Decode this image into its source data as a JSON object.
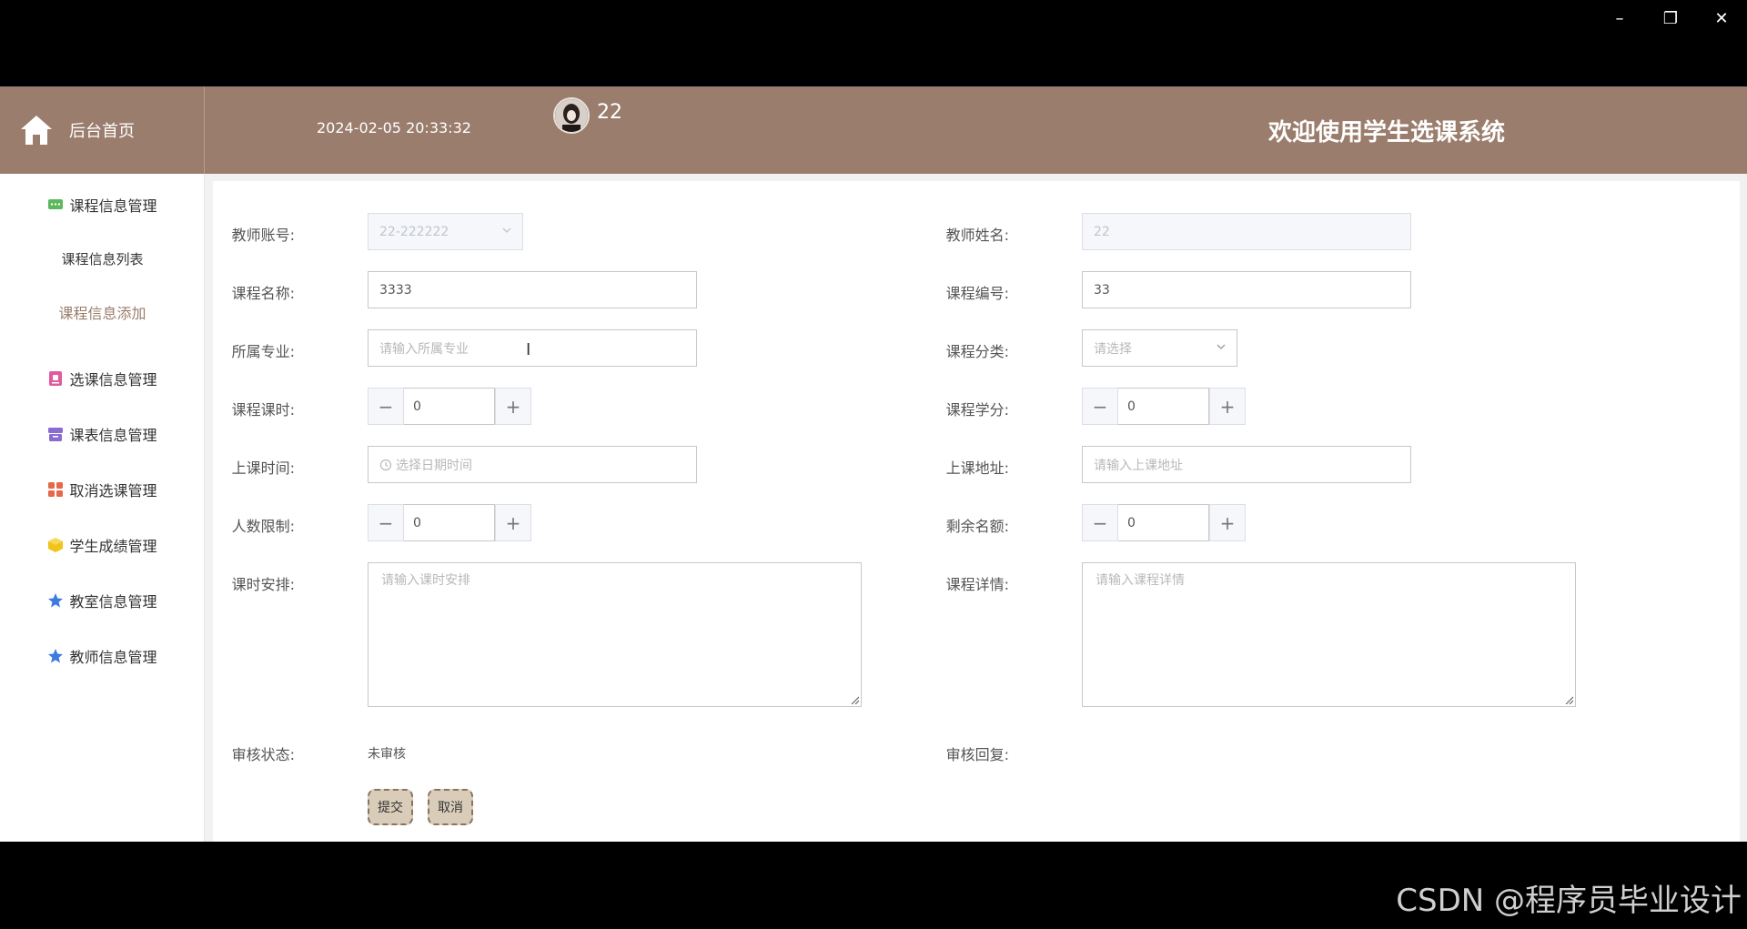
{
  "window": {
    "controls": [
      "–",
      "❐",
      "✕"
    ]
  },
  "header": {
    "home_label": "后台首页",
    "datetime": "2024-02-05 20:33:32",
    "username": "22",
    "welcome": "欢迎使用学生选课系统"
  },
  "sidebar": {
    "items": [
      {
        "label": "课程信息管理",
        "icon": "chat-icon",
        "color": "#5cb85c"
      },
      {
        "label": "课程信息列表"
      },
      {
        "label": "课程信息添加"
      },
      {
        "label": "选课信息管理",
        "icon": "clipboard-icon",
        "color": "#e05a9f"
      },
      {
        "label": "课表信息管理",
        "icon": "archive-icon",
        "color": "#8a6bd1"
      },
      {
        "label": "取消选课管理",
        "icon": "grid-icon",
        "color": "#e8674a"
      },
      {
        "label": "学生成绩管理",
        "icon": "cube-icon",
        "color": "#f0c419"
      },
      {
        "label": "教室信息管理",
        "icon": "star-icon",
        "color": "#3d7be0"
      },
      {
        "label": "教师信息管理",
        "icon": "star-icon",
        "color": "#3d7be0"
      }
    ]
  },
  "form": {
    "teacher_account": {
      "label": "教师账号:",
      "value": "22-222222"
    },
    "teacher_name": {
      "label": "教师姓名:",
      "value": "22"
    },
    "course_name": {
      "label": "课程名称:",
      "value": "3333"
    },
    "course_code": {
      "label": "课程编号:",
      "value": "33"
    },
    "major": {
      "label": "所属专业:",
      "placeholder": "请输入所属专业"
    },
    "category": {
      "label": "课程分类:",
      "placeholder": "请选择"
    },
    "hours": {
      "label": "课程课时:",
      "value": "0"
    },
    "credits": {
      "label": "课程学分:",
      "value": "0"
    },
    "class_time": {
      "label": "上课时间:",
      "placeholder": "选择日期时间"
    },
    "class_address": {
      "label": "上课地址:",
      "placeholder": "请输入上课地址"
    },
    "capacity": {
      "label": "人数限制:",
      "value": "0"
    },
    "remaining": {
      "label": "剩余名额:",
      "value": "0"
    },
    "schedule": {
      "label": "课时安排:",
      "placeholder": "请输入课时安排"
    },
    "details": {
      "label": "课程详情:",
      "placeholder": "请输入课程详情"
    },
    "review_status": {
      "label": "审核状态:",
      "value": "未审核"
    },
    "review_reply": {
      "label": "审核回复:"
    },
    "submit_label": "提交",
    "cancel_label": "取消"
  },
  "watermark": "CSDN @程序员毕业设计",
  "colors": {
    "header": "#9a7d6c",
    "button": "#d9cdb9"
  }
}
